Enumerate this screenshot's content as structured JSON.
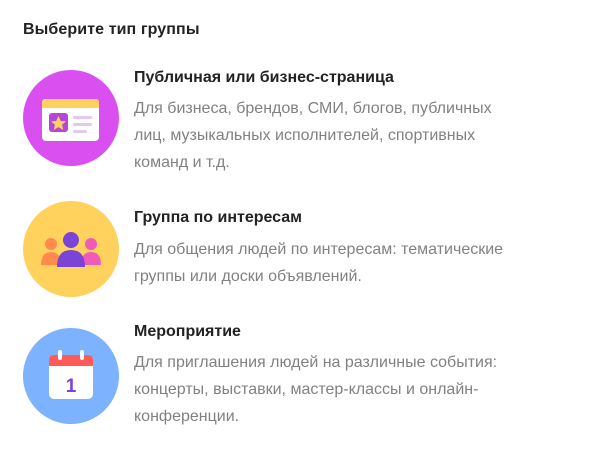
{
  "heading": "Выберите тип группы",
  "options": [
    {
      "title": "Публичная или бизнес-страница",
      "description_lines": [
        "Для бизнеса, брендов, СМИ, блогов, публичных",
        "лиц, музыкальных исполнителей, спортивных",
        "команд и т.д."
      ],
      "icon": "public-page-icon",
      "color": "#d94ff0"
    },
    {
      "title": "Группа по интересам",
      "description_lines": [
        "Для общения людей по интересам: тематические",
        "группы или доски объявлений."
      ],
      "icon": "people-group-icon",
      "color": "#ffd25e"
    },
    {
      "title": "Мероприятие",
      "description_lines": [
        "Для приглашения людей на различные события:",
        "концерты, выставки, мастер-классы и онлайн-",
        "конференции."
      ],
      "icon": "calendar-icon",
      "calendar_day": "1",
      "color": "#7db2ff"
    }
  ]
}
